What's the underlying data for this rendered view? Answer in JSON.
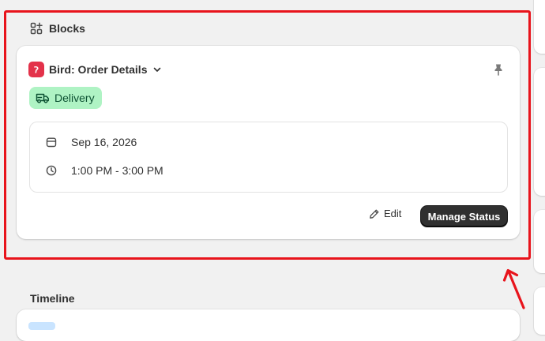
{
  "blocks": {
    "title": "Blocks",
    "card": {
      "app_name": "Bird: Order Details",
      "badge": "Delivery",
      "date": "Sep 16, 2026",
      "time_window": "1:00 PM - 3:00 PM",
      "edit_label": "Edit",
      "manage_label": "Manage Status"
    }
  },
  "timeline": {
    "title": "Timeline"
  },
  "colors": {
    "highlight": "#e8141c",
    "app_logo": "#e3324a",
    "badge_bg": "#aff3c4",
    "badge_text": "#0c5132",
    "primary_button": "#303030"
  },
  "icons": {
    "blocks": "blocks-icon",
    "dropdown": "chevron-down-icon",
    "pin": "pin-icon",
    "delivery": "truck-icon",
    "date": "calendar-icon",
    "time": "clock-icon",
    "edit": "pencil-icon",
    "annotation": "arrow-icon"
  }
}
